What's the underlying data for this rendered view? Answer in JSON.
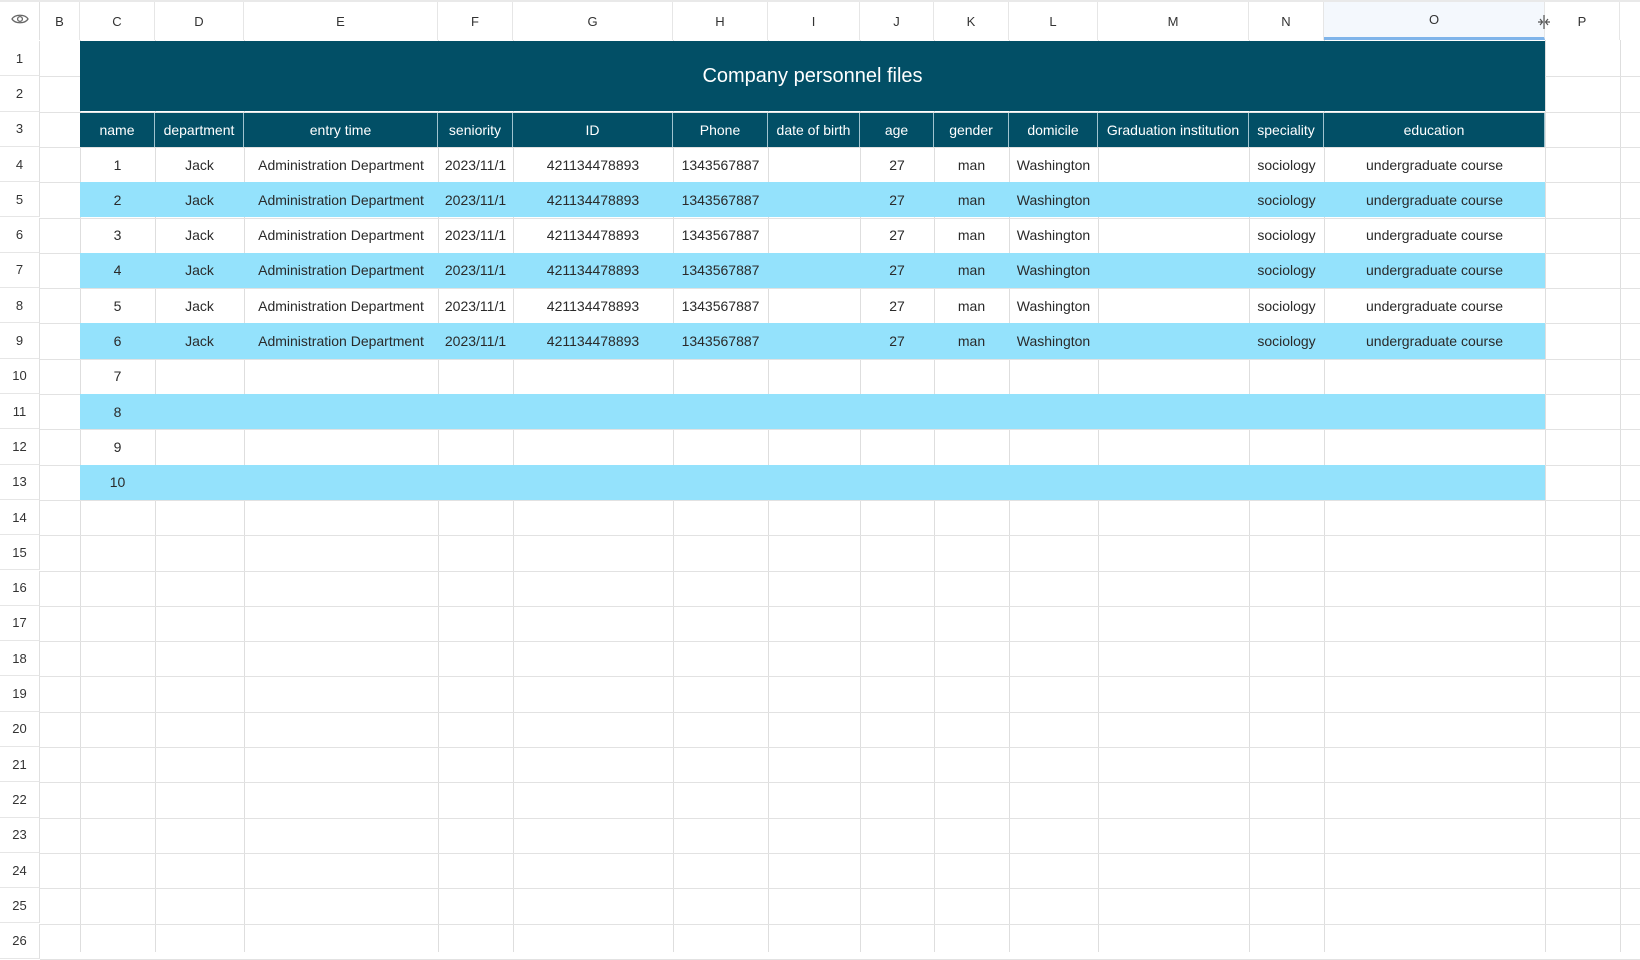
{
  "sheet": {
    "columns": [
      "B",
      "C",
      "D",
      "E",
      "F",
      "G",
      "H",
      "I",
      "J",
      "K",
      "L",
      "M",
      "N",
      "O",
      "P"
    ],
    "selected_column": "O",
    "row_numbers": [
      "1",
      "2",
      "3",
      "4",
      "5",
      "6",
      "7",
      "8",
      "9",
      "10",
      "11",
      "12",
      "13",
      "14",
      "15",
      "16",
      "17",
      "18",
      "19",
      "20",
      "21",
      "22",
      "23",
      "24",
      "25",
      "26"
    ]
  },
  "table": {
    "title": "Company personnel files",
    "headers": [
      "name",
      "department",
      "entry time",
      "seniority",
      "ID",
      "Phone",
      "date of birth",
      "age",
      "gender",
      "domicile",
      "Graduation institution",
      "speciality",
      "education"
    ],
    "rows": [
      [
        "1",
        "Jack",
        "Administration Department",
        "2023/11/1",
        "421134478893",
        "1343567887",
        "",
        "27",
        "man",
        "Washington",
        "",
        "sociology",
        "undergraduate course"
      ],
      [
        "2",
        "Jack",
        "Administration Department",
        "2023/11/1",
        "421134478893",
        "1343567887",
        "",
        "27",
        "man",
        "Washington",
        "",
        "sociology",
        "undergraduate course"
      ],
      [
        "3",
        "Jack",
        "Administration Department",
        "2023/11/1",
        "421134478893",
        "1343567887",
        "",
        "27",
        "man",
        "Washington",
        "",
        "sociology",
        "undergraduate course"
      ],
      [
        "4",
        "Jack",
        "Administration Department",
        "2023/11/1",
        "421134478893",
        "1343567887",
        "",
        "27",
        "man",
        "Washington",
        "",
        "sociology",
        "undergraduate course"
      ],
      [
        "5",
        "Jack",
        "Administration Department",
        "2023/11/1",
        "421134478893",
        "1343567887",
        "",
        "27",
        "man",
        "Washington",
        "",
        "sociology",
        "undergraduate course"
      ],
      [
        "6",
        "Jack",
        "Administration Department",
        "2023/11/1",
        "421134478893",
        "1343567887",
        "",
        "27",
        "man",
        "Washington",
        "",
        "sociology",
        "undergraduate course"
      ],
      [
        "7",
        "",
        "",
        "",
        "",
        "",
        "",
        "",
        "",
        "",
        "",
        "",
        ""
      ],
      [
        "8",
        "",
        "",
        "",
        "",
        "",
        "",
        "",
        "",
        "",
        "",
        "",
        ""
      ],
      [
        "9",
        "",
        "",
        "",
        "",
        "",
        "",
        "",
        "",
        "",
        "",
        "",
        ""
      ],
      [
        "10",
        "",
        "",
        "",
        "",
        "",
        "",
        "",
        "",
        "",
        "",
        "",
        ""
      ]
    ]
  },
  "colors": {
    "header_bg": "#024f66",
    "band_bg": "#94e2fc",
    "grid": "#dedede"
  },
  "icons": {
    "corner": "eye-icon",
    "column_resize": "column-resize-icon"
  }
}
